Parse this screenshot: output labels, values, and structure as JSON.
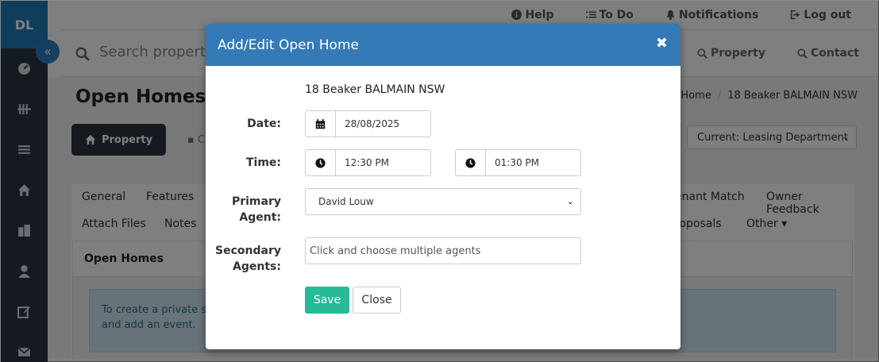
{
  "sidebar": {
    "initials": "DL",
    "collapse_icon": "double-chevron-left-icon",
    "icons": [
      "dashboard-icon",
      "tally-icon",
      "menu-icon",
      "home-icon",
      "building-icon",
      "user-icon",
      "edit-icon",
      "mail-icon"
    ]
  },
  "topbar": {
    "help": "Help",
    "todo": "To Do",
    "notifications": "Notifications",
    "logout": "Log out"
  },
  "search": {
    "placeholder": "Search propertie",
    "property_link": "Property",
    "contact_link": "Contact"
  },
  "page": {
    "title": "Open Homes",
    "breadcrumb": [
      "Home",
      "18 Beaker BALMAIN NSW"
    ],
    "property_button": "Property",
    "doc_tab": "C",
    "department": "Current: Leasing Department"
  },
  "tabs": {
    "general": "General",
    "features": "Features",
    "tenant_match": "enant Match",
    "owner_feedback": "Owner Feedback",
    "attach_files": "Attach Files",
    "notes": "Notes",
    "proposals": "roposals",
    "other": "Other ▾"
  },
  "open_homes_panel": {
    "title": "Open Homes",
    "info_line1": "To create a private sch",
    "info_line2": "and add an event."
  },
  "modal": {
    "title": "Add/Edit Open Home",
    "close_glyph": "✖",
    "address": "18 Beaker BALMAIN NSW",
    "date_label": "Date:",
    "date_value": "28/08/2025",
    "time_label": "Time:",
    "time_start": "12:30 PM",
    "time_end": "01:30 PM",
    "primary_label_1": "Primary",
    "primary_label_2": "Agent:",
    "primary_agent": "David Louw",
    "secondary_label_1": "Secondary",
    "secondary_label_2": "Agents:",
    "secondary_placeholder": "Click and choose multiple agents",
    "save": "Save",
    "close": "Close"
  },
  "colors": {
    "sidebar": "#2a3443",
    "logo": "#1e7bb8",
    "modal_header": "#337ab7",
    "save_button": "#26b99a",
    "info_box": "#cfe6f2"
  }
}
